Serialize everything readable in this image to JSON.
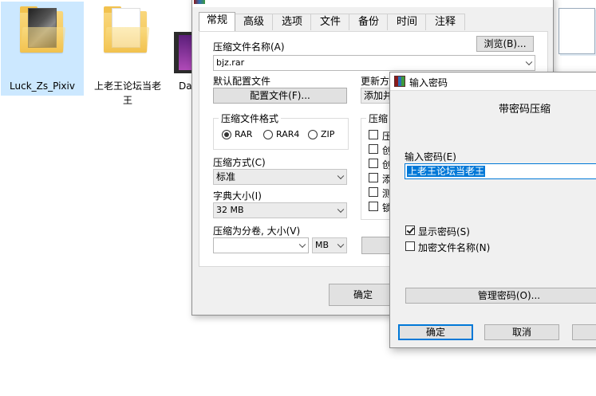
{
  "desktop": {
    "icons": [
      {
        "label": "Luck_Zs_Pixiv"
      },
      {
        "label_line1": "上老王论坛当老",
        "label_line2": "王"
      },
      {
        "label": "Da"
      }
    ]
  },
  "archive_dialog": {
    "tabs": [
      "常规",
      "高级",
      "选项",
      "文件",
      "备份",
      "时间",
      "注释"
    ],
    "archive_name_label": "压缩文件名称(A)",
    "browse_button": "浏览(B)...",
    "archive_name_value": "bjz.rar",
    "default_profile_label": "默认配置文件",
    "profiles_button": "配置文件(F)...",
    "update_mode_label": "更新方",
    "update_mode_value": "添加并",
    "format_group_label": "压缩文件格式",
    "format_options": [
      "RAR",
      "RAR4",
      "ZIP"
    ],
    "format_selected": "RAR",
    "options_group_label": "压缩",
    "archive_options": [
      "压",
      "创",
      "创",
      "添",
      "测",
      "锁"
    ],
    "method_label": "压缩方式(C)",
    "method_value": "标准",
    "dict_label": "字典大小(I)",
    "dict_value": "32 MB",
    "split_label": "压缩为分卷, 大小(V)",
    "split_value": "",
    "split_unit": "MB",
    "ok_button": "确定"
  },
  "password_dialog": {
    "title": "输入密码",
    "heading": "带密码压缩",
    "password_label": "输入密码(E)",
    "password_value": "上老王论坛当老王",
    "show_password_label": "显示密码(S)",
    "show_password_checked": true,
    "encrypt_names_label": "加密文件名称(N)",
    "encrypt_names_checked": false,
    "manage_button": "管理密码(O)...",
    "ok_button": "确定",
    "cancel_button": "取消"
  },
  "colors": {
    "accent": "#0078d7",
    "selection_bg": "#cce8ff",
    "window_bg": "#f0f0f0"
  }
}
